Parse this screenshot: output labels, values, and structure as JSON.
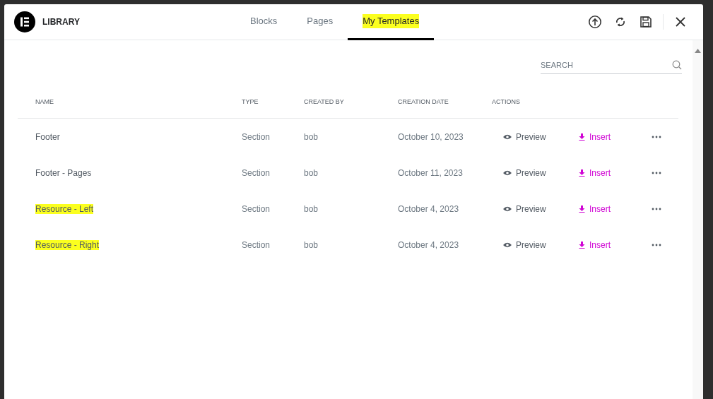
{
  "header": {
    "title": "LIBRARY"
  },
  "tabs": [
    {
      "label": "Blocks",
      "selected": false,
      "highlighted": false
    },
    {
      "label": "Pages",
      "selected": false,
      "highlighted": false
    },
    {
      "label": "My Templates",
      "selected": true,
      "highlighted": true
    }
  ],
  "search": {
    "placeholder": "SEARCH"
  },
  "table": {
    "columns": [
      "NAME",
      "TYPE",
      "CREATED BY",
      "CREATION DATE",
      "ACTIONS"
    ],
    "rows": [
      {
        "name": "Footer",
        "highlighted": false,
        "type": "Section",
        "created_by": "bob",
        "date": "October 10, 2023",
        "preview": "Preview",
        "insert": "Insert"
      },
      {
        "name": "Footer - Pages",
        "highlighted": false,
        "type": "Section",
        "created_by": "bob",
        "date": "October 11, 2023",
        "preview": "Preview",
        "insert": "Insert"
      },
      {
        "name": "Resource - Left",
        "highlighted": true,
        "type": "Section",
        "created_by": "bob",
        "date": "October 4, 2023",
        "preview": "Preview",
        "insert": "Insert"
      },
      {
        "name": "Resource - Right",
        "highlighted": true,
        "type": "Section",
        "created_by": "bob",
        "date": "October 4, 2023",
        "preview": "Preview",
        "insert": "Insert"
      }
    ]
  }
}
